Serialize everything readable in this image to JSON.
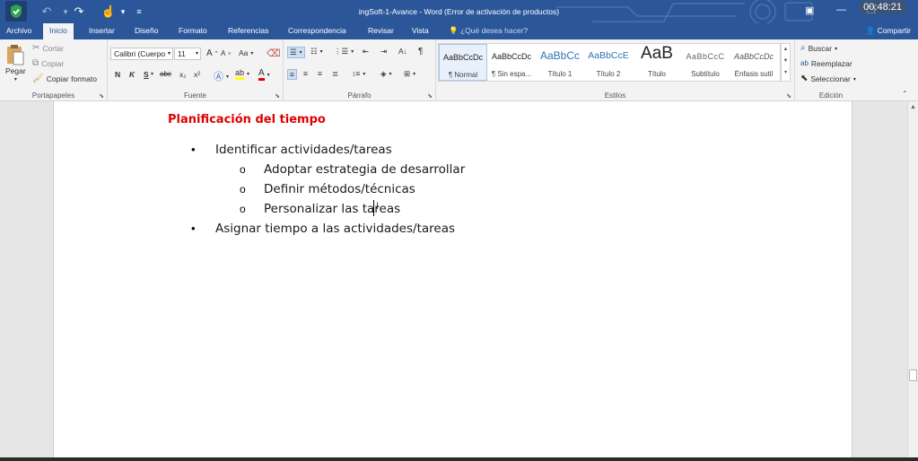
{
  "window": {
    "title": "ingSoft-1-Avance - Word (Error de activación de productos)",
    "clock": "00:48:21"
  },
  "quick_access": {
    "undo_icon": "undo-icon",
    "redo_icon": "redo-icon",
    "touch_icon": "touch-mode-icon"
  },
  "tabs": [
    {
      "label": "Archivo"
    },
    {
      "label": "Inicio"
    },
    {
      "label": "Insertar"
    },
    {
      "label": "Diseño"
    },
    {
      "label": "Formato"
    },
    {
      "label": "Referencias"
    },
    {
      "label": "Correspondencia"
    },
    {
      "label": "Revisar"
    },
    {
      "label": "Vista"
    }
  ],
  "tell_me": "¿Qué desea hacer?",
  "share": "Compartir",
  "ribbon": {
    "clipboard": {
      "label": "Portapapeles",
      "paste": "Pegar",
      "cut": "Cortar",
      "copy": "Copiar",
      "format_painter": "Copiar formato"
    },
    "font": {
      "label": "Fuente",
      "font_name": "Calibri (Cuerpo",
      "font_size": "11",
      "bold": "N",
      "italic": "K",
      "underline": "S",
      "strike": "abc",
      "subscript": "x₂",
      "superscript": "x²",
      "grow": "A",
      "shrink": "A",
      "case": "Aa"
    },
    "paragraph": {
      "label": "Párrafo"
    },
    "styles": {
      "label": "Estilos",
      "items": [
        {
          "preview": "AaBbCcDc",
          "name": "¶ Normal"
        },
        {
          "preview": "AaBbCcDc",
          "name": "¶ Sin espa..."
        },
        {
          "preview": "AaBbCc",
          "name": "Título 1"
        },
        {
          "preview": "AaBbCcE",
          "name": "Título 2"
        },
        {
          "preview": "AaB",
          "name": "Título"
        },
        {
          "preview": "AaBbCcC",
          "name": "Subtítulo"
        },
        {
          "preview": "AaBbCcDc",
          "name": "Énfasis sutil"
        }
      ]
    },
    "editing": {
      "label": "Edición",
      "find": "Buscar",
      "replace": "Reemplazar",
      "select": "Seleccionar"
    }
  },
  "document": {
    "heading": "Planificación del tiempo",
    "items": [
      {
        "text": "Identificar actividades/tareas",
        "children": [
          "Adoptar estrategia de desarrollar",
          "Definir métodos/técnicas",
          "Personalizar las tareas"
        ]
      },
      {
        "text": "Asignar tiempo a las actividades/tareas"
      }
    ]
  },
  "colors": {
    "accent": "#2b579a",
    "heading": "#e00000"
  }
}
